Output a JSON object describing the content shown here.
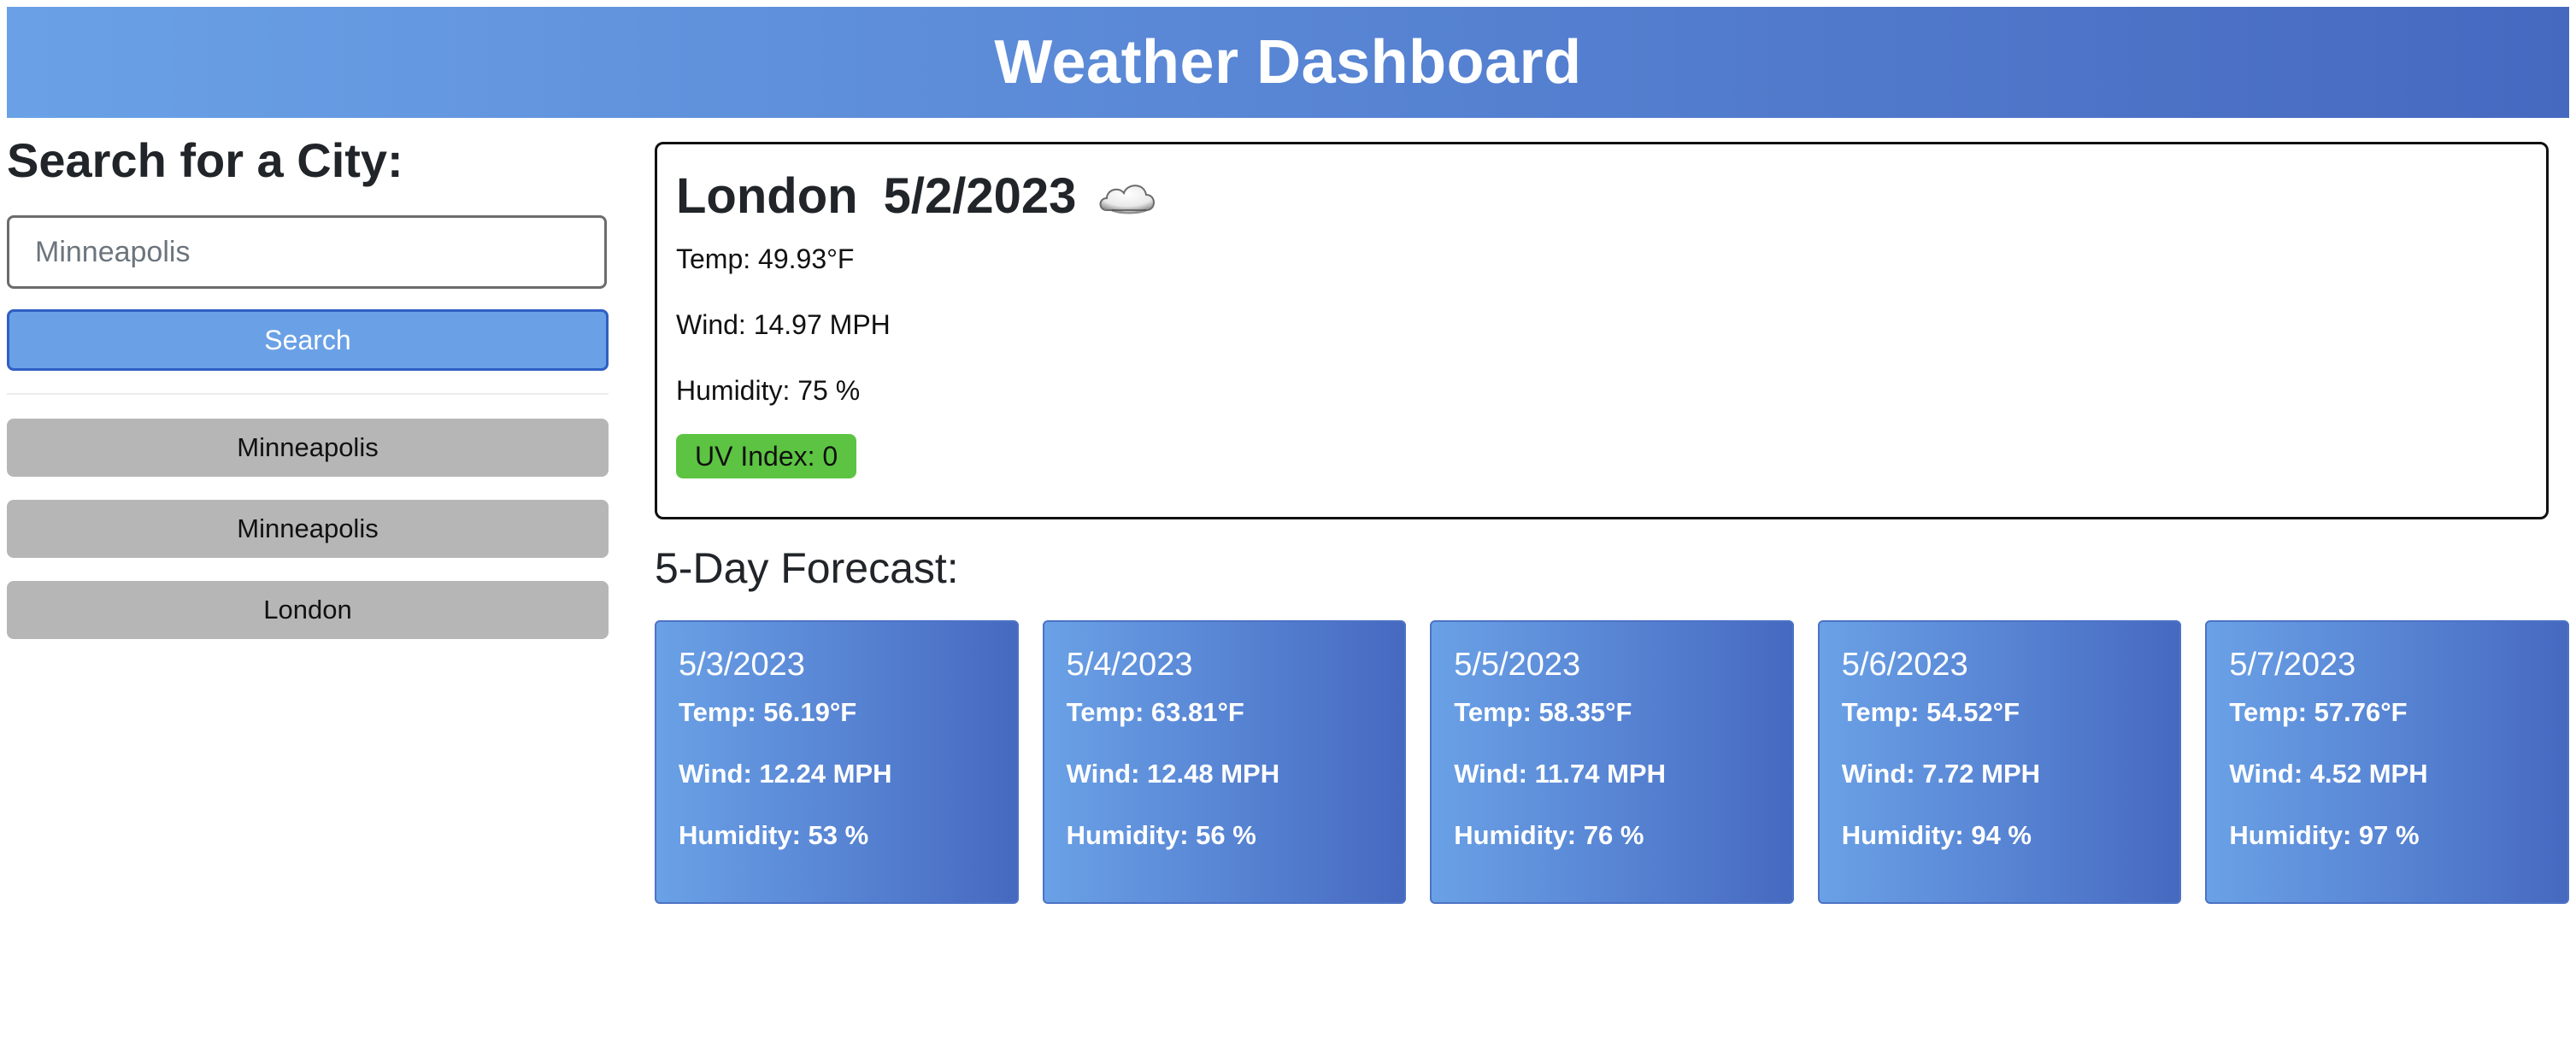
{
  "header": {
    "title": "Weather Dashboard"
  },
  "sidebar": {
    "heading": "Search for a City:",
    "search": {
      "placeholder": "Minneapolis",
      "value": ""
    },
    "search_button": "Search",
    "history": [
      "Minneapolis",
      "Minneapolis",
      "London"
    ]
  },
  "current": {
    "city": "London",
    "date": "5/2/2023",
    "icon": "cloud-icon",
    "temp": "Temp: 49.93°F",
    "wind": "Wind: 14.97 MPH",
    "humidity": "Humidity: 75 %",
    "uv": "UV Index: 0",
    "uv_color": "#5cc442"
  },
  "forecast": {
    "heading": "5-Day Forecast:",
    "days": [
      {
        "date": "5/3/2023",
        "temp": "Temp: 56.19°F",
        "wind": "Wind: 12.24 MPH",
        "humidity": "Humidity: 53 %"
      },
      {
        "date": "5/4/2023",
        "temp": "Temp: 63.81°F",
        "wind": "Wind: 12.48 MPH",
        "humidity": "Humidity: 56 %"
      },
      {
        "date": "5/5/2023",
        "temp": "Temp: 58.35°F",
        "wind": "Wind: 11.74 MPH",
        "humidity": "Humidity: 76 %"
      },
      {
        "date": "5/6/2023",
        "temp": "Temp: 54.52°F",
        "wind": "Wind: 7.72 MPH",
        "humidity": "Humidity: 94 %"
      },
      {
        "date": "5/7/2023",
        "temp": "Temp: 57.76°F",
        "wind": "Wind: 4.52 MPH",
        "humidity": "Humidity: 97 %"
      }
    ]
  },
  "colors": {
    "header_gradient_start": "#6aa1e6",
    "header_gradient_end": "#4669c0",
    "search_button": "#6aa1e6",
    "history_button": "#b6b6b6"
  }
}
